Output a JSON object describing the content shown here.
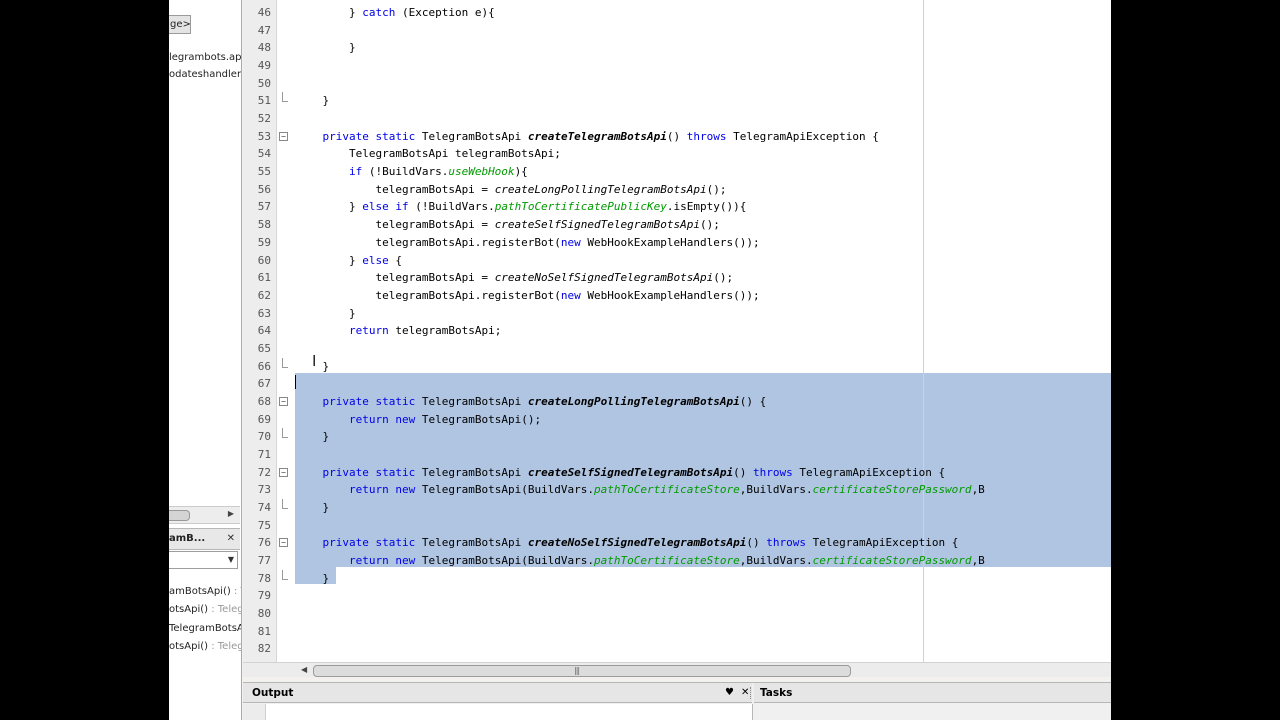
{
  "navigator": {
    "package_label": "ge>",
    "items": [
      "legrambots.api",
      "odateshandlers"
    ],
    "header_title": "amB...",
    "close_glyph": "✕",
    "members": [
      {
        "name": "amBotsApi()",
        "type": " : Te"
      },
      {
        "name": "otsApi()",
        "type": " : Teleg"
      },
      {
        "name": "TelegramBotsAp",
        "type": ""
      },
      {
        "name": "otsApi()",
        "type": " : Teleg"
      }
    ]
  },
  "editor": {
    "lines": [
      {
        "num": "46",
        "fold": "",
        "code": "        } catch (Exception e){"
      },
      {
        "num": "47",
        "fold": "",
        "code": ""
      },
      {
        "num": "48",
        "fold": "",
        "code": "        }"
      },
      {
        "num": "49",
        "fold": "",
        "code": ""
      },
      {
        "num": "50",
        "fold": "",
        "code": ""
      },
      {
        "num": "51",
        "fold": "end",
        "code": "    }"
      },
      {
        "num": "52",
        "fold": "",
        "code": ""
      },
      {
        "num": "53",
        "fold": "−",
        "code": "    private static TelegramBotsApi createTelegramBotsApi() throws TelegramApiException {"
      },
      {
        "num": "54",
        "fold": "",
        "code": "        TelegramBotsApi telegramBotsApi;"
      },
      {
        "num": "55",
        "fold": "",
        "code": "        if (!BuildVars.useWebHook){"
      },
      {
        "num": "56",
        "fold": "",
        "code": "            telegramBotsApi = createLongPollingTelegramBotsApi();"
      },
      {
        "num": "57",
        "fold": "",
        "code": "        } else if (!BuildVars.pathToCertificatePublicKey.isEmpty()){"
      },
      {
        "num": "58",
        "fold": "",
        "code": "            telegramBotsApi = createSelfSignedTelegramBotsApi();"
      },
      {
        "num": "59",
        "fold": "",
        "code": "            telegramBotsApi.registerBot(new WebHookExampleHandlers());"
      },
      {
        "num": "60",
        "fold": "",
        "code": "        } else {"
      },
      {
        "num": "61",
        "fold": "",
        "code": "            telegramBotsApi = createNoSelfSignedTelegramBotsApi();"
      },
      {
        "num": "62",
        "fold": "",
        "code": "            telegramBotsApi.registerBot(new WebHookExampleHandlers());"
      },
      {
        "num": "63",
        "fold": "",
        "code": "        }"
      },
      {
        "num": "64",
        "fold": "",
        "code": "        return telegramBotsApi;"
      },
      {
        "num": "65",
        "fold": "",
        "code": ""
      },
      {
        "num": "66",
        "fold": "end",
        "code": "    }"
      },
      {
        "num": "67",
        "fold": "",
        "code": ""
      },
      {
        "num": "68",
        "fold": "−",
        "code": "    private static TelegramBotsApi createLongPollingTelegramBotsApi() {"
      },
      {
        "num": "69",
        "fold": "",
        "code": "        return new TelegramBotsApi();"
      },
      {
        "num": "70",
        "fold": "end",
        "code": "    }"
      },
      {
        "num": "71",
        "fold": "",
        "code": ""
      },
      {
        "num": "72",
        "fold": "−",
        "code": "    private static TelegramBotsApi createSelfSignedTelegramBotsApi() throws TelegramApiException {"
      },
      {
        "num": "73",
        "fold": "",
        "code": "        return new TelegramBotsApi(BuildVars.pathToCertificateStore,BuildVars.certificateStorePassword,B"
      },
      {
        "num": "74",
        "fold": "end",
        "code": "    }"
      },
      {
        "num": "75",
        "fold": "",
        "code": ""
      },
      {
        "num": "76",
        "fold": "−",
        "code": "    private static TelegramBotsApi createNoSelfSignedTelegramBotsApi() throws TelegramApiException {"
      },
      {
        "num": "77",
        "fold": "",
        "code": "        return new TelegramBotsApi(BuildVars.pathToCertificateStore,BuildVars.certificateStorePassword,B"
      },
      {
        "num": "78",
        "fold": "end",
        "code": "    }"
      },
      {
        "num": "79",
        "fold": "",
        "code": ""
      },
      {
        "num": "80",
        "fold": "",
        "code": ""
      },
      {
        "num": "81",
        "fold": "",
        "code": ""
      },
      {
        "num": "82",
        "fold": "",
        "code": ""
      }
    ],
    "keywords": [
      "catch",
      "private",
      "static",
      "throws",
      "if",
      "else",
      "return",
      "new"
    ],
    "fields": [
      "useWebHook",
      "pathToCertificatePublicKey",
      "pathToCertificateStore",
      "certificateStorePassword"
    ],
    "method_decls": [
      "createTelegramBotsApi",
      "createLongPollingTelegramBotsApi",
      "createSelfSignedTelegramBotsApi",
      "createNoSelfSignedTelegramBotsApi"
    ],
    "selection": {
      "from_line": "67",
      "to_line": "78"
    }
  },
  "bottom": {
    "output_label": "Output",
    "tasks_label": "Tasks",
    "pin_glyph": "♥",
    "close_glyph": "✕"
  },
  "colors": {
    "keyword": "#0000e6",
    "field": "#009900",
    "selection": "#b0c5e1",
    "line_number": "#555555"
  }
}
